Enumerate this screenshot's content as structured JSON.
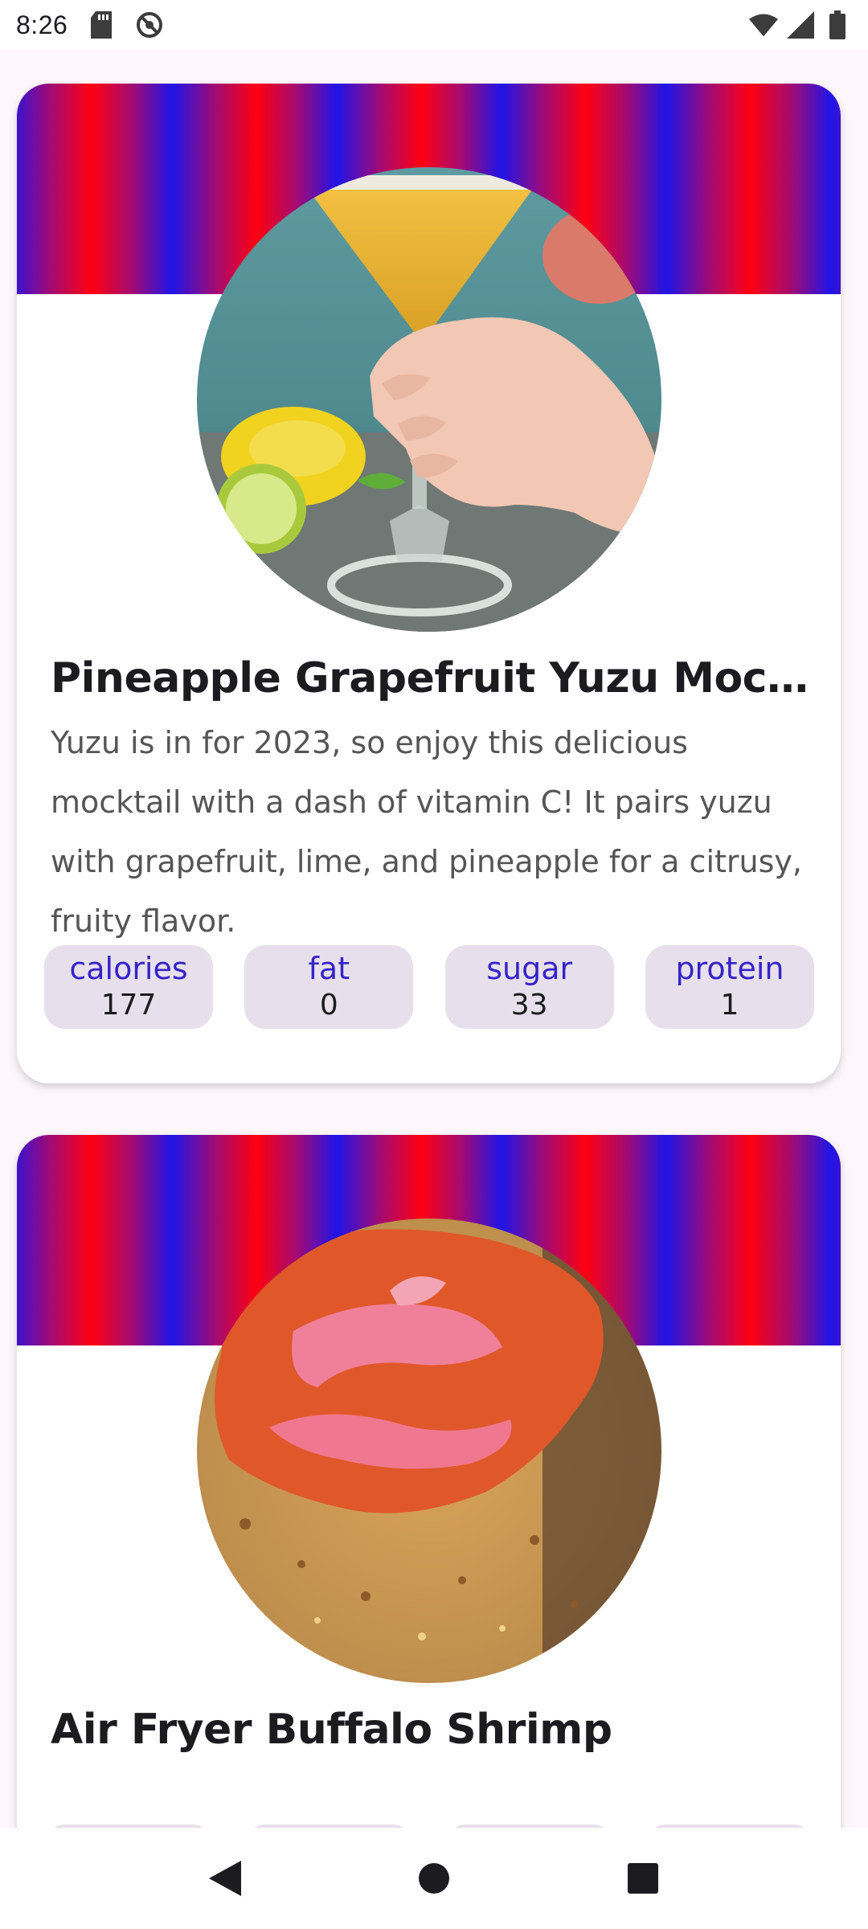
{
  "status_bar": {
    "time": "8:26",
    "icons_left": [
      "sd-card-icon",
      "no-disturb-icon"
    ],
    "icons_right": [
      "wifi-icon",
      "signal-icon",
      "battery-icon"
    ]
  },
  "cards": [
    {
      "title": "Pineapple Grapefruit Yuzu Mocktail",
      "description": "Yuzu is in for 2023, so enjoy this delicious mocktail with a dash of vitamin C! It pairs yuzu with grapefruit, lime, and pineapple for a citrusy, fruity flavor.",
      "nutrients": [
        {
          "label": "calories",
          "value": "177"
        },
        {
          "label": "fat",
          "value": "0"
        },
        {
          "label": "sugar",
          "value": "33"
        },
        {
          "label": "protein",
          "value": "1"
        }
      ]
    },
    {
      "title": "Air Fryer Buffalo Shrimp",
      "description": "",
      "nutrients": [
        {
          "label": "calories",
          "value": ""
        },
        {
          "label": "fat",
          "value": ""
        },
        {
          "label": "sugar",
          "value": ""
        },
        {
          "label": "protein",
          "value": ""
        }
      ]
    }
  ],
  "colors": {
    "banner_blue": "#1f14e8",
    "banner_red": "#ff0010",
    "chip_background": "#e7e0ec",
    "chip_label": "#3523c8"
  },
  "nav_bar": {
    "buttons": [
      "back-icon",
      "home-icon",
      "recents-icon"
    ]
  }
}
